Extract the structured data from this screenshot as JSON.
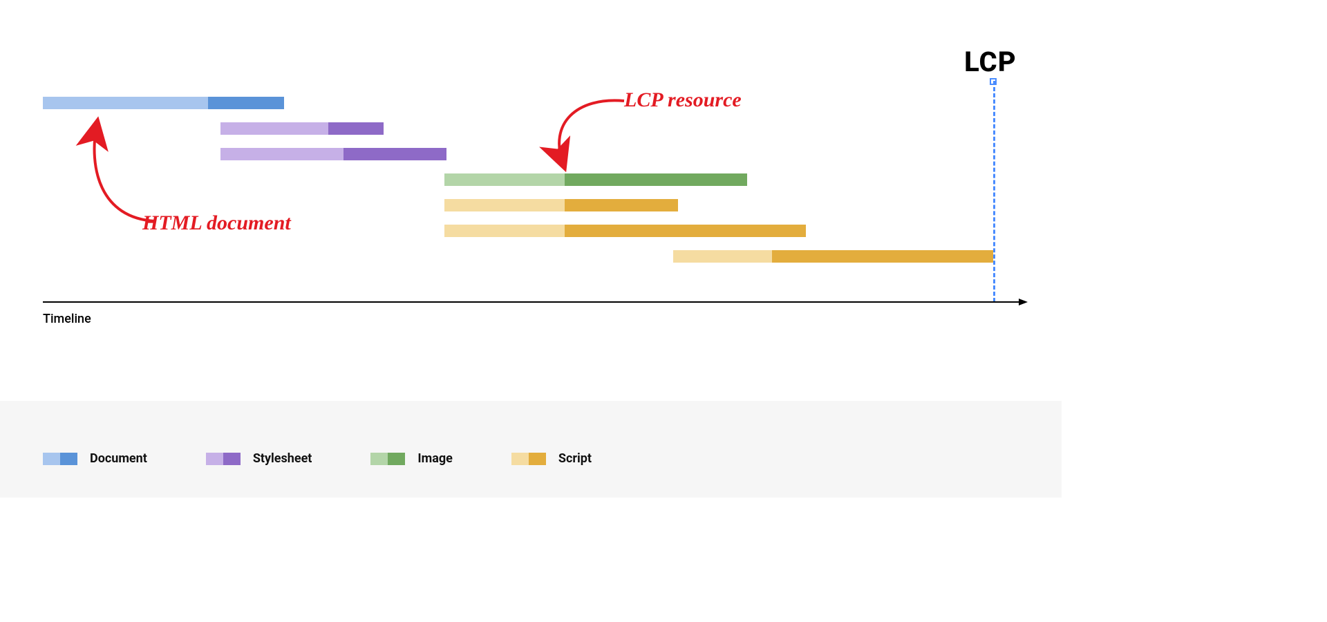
{
  "title_marker": "LCP",
  "axis_label": "Timeline",
  "annotations": {
    "html_document": "HTML document",
    "lcp_resource": "LCP resource"
  },
  "legend": [
    {
      "label": "Document",
      "light": "#a7c5ee",
      "dark": "#5a93d8"
    },
    {
      "label": "Stylesheet",
      "light": "#c6b0e7",
      "dark": "#8e6ac7"
    },
    {
      "label": "Image",
      "light": "#b3d5a8",
      "dark": "#71a95f"
    },
    {
      "label": "Script",
      "light": "#f5dca1",
      "dark": "#e3ad3d"
    }
  ],
  "chart_data": {
    "type": "gantt",
    "title": "Network waterfall with LCP marker",
    "xlabel": "Timeline",
    "ylabel": "",
    "x_units": "percent_of_timeline_width",
    "lcp_marker_x": 96.5,
    "rows": [
      {
        "type": "Document",
        "row": 0,
        "start": 0,
        "split": 16.8,
        "end": 24.5
      },
      {
        "type": "Stylesheet",
        "row": 1,
        "start": 18.0,
        "split": 29.0,
        "end": 34.6
      },
      {
        "type": "Stylesheet",
        "row": 2,
        "start": 18.0,
        "split": 30.5,
        "end": 41.0
      },
      {
        "type": "Image",
        "row": 3,
        "start": 40.8,
        "split": 53.0,
        "end": 71.5
      },
      {
        "type": "Script",
        "row": 4,
        "start": 40.8,
        "split": 53.0,
        "end": 64.5
      },
      {
        "type": "Script",
        "row": 5,
        "start": 40.8,
        "split": 53.0,
        "end": 77.5
      },
      {
        "type": "Script",
        "row": 6,
        "start": 64.0,
        "split": 74.0,
        "end": 96.5
      }
    ],
    "annotations": [
      {
        "text_key": "html_document",
        "targets_row": 0
      },
      {
        "text_key": "lcp_resource",
        "targets_row": 3
      }
    ],
    "colors": {
      "Document": {
        "light": "#a7c5ee",
        "dark": "#5a93d8"
      },
      "Stylesheet": {
        "light": "#c6b0e7",
        "dark": "#8e6ac7"
      },
      "Image": {
        "light": "#b3d5a8",
        "dark": "#71a95f"
      },
      "Script": {
        "light": "#f5dca1",
        "dark": "#e3ad3d"
      }
    }
  }
}
